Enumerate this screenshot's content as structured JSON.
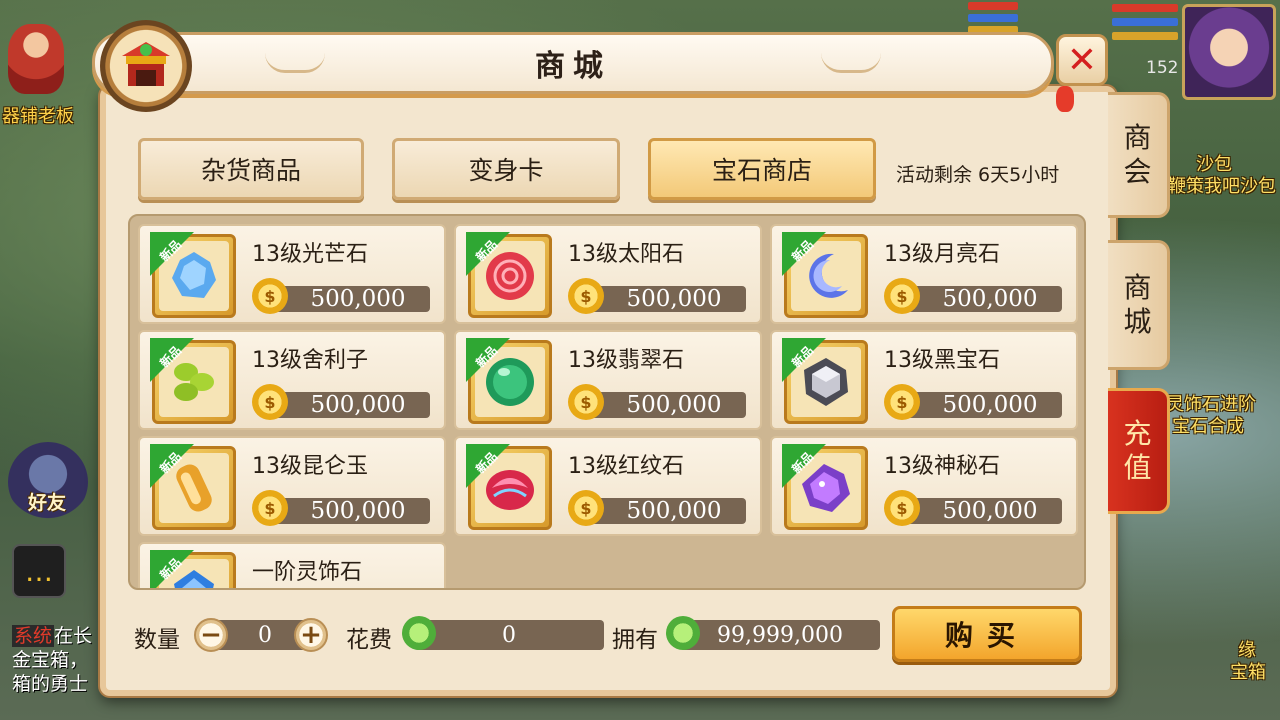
{
  "background": {
    "npc_name": "器铺老板",
    "level_text": "152",
    "friend_label": "好友",
    "scene_texts": [
      "沙包",
      "鞭策我吧沙包",
      "灵饰石进阶",
      "宝石合成",
      "缘",
      "宝箱"
    ],
    "system_chat": {
      "tag": "系统",
      "lines": [
        "在长",
        "金宝箱，",
        "箱的勇士"
      ]
    }
  },
  "window": {
    "title": "商城",
    "close_label": "✕"
  },
  "tabs": [
    {
      "label": "杂货商品",
      "active": false
    },
    {
      "label": "变身卡",
      "active": false
    },
    {
      "label": "宝石商店",
      "active": true
    }
  ],
  "activity": "活动剩余 6天5小时",
  "new_badge": "新品",
  "items": [
    {
      "name": "13级光芒石",
      "price": "500,000",
      "gem": "blue-crystal-icon"
    },
    {
      "name": "13级太阳石",
      "price": "500,000",
      "gem": "red-sun-stone-icon"
    },
    {
      "name": "13级月亮石",
      "price": "500,000",
      "gem": "blue-moon-stone-icon"
    },
    {
      "name": "13级舍利子",
      "price": "500,000",
      "gem": "green-relic-icon"
    },
    {
      "name": "13级翡翠石",
      "price": "500,000",
      "gem": "green-jade-orb-icon"
    },
    {
      "name": "13级黑宝石",
      "price": "500,000",
      "gem": "black-gem-icon"
    },
    {
      "name": "13级昆仑玉",
      "price": "500,000",
      "gem": "orange-jade-icon"
    },
    {
      "name": "13级红纹石",
      "price": "500,000",
      "gem": "red-swirl-stone-icon"
    },
    {
      "name": "13级神秘石",
      "price": "500,000",
      "gem": "purple-mystic-stone-icon"
    },
    {
      "name": "一阶灵饰石",
      "price": "",
      "gem": "blue-ornament-stone-icon"
    }
  ],
  "bottom": {
    "qty_label": "数量",
    "qty_value": "0",
    "minus": "−",
    "plus": "+",
    "cost_label": "花费",
    "cost_value": "0",
    "own_label": "拥有",
    "own_value": "99,999,000",
    "buy_label": "购买"
  },
  "side_tabs": [
    {
      "label": "商会"
    },
    {
      "label": "商城"
    },
    {
      "label": "充值"
    }
  ],
  "colors": {
    "accent": "#f3a52c",
    "price_bar": "#786552",
    "new_badge": "#2fa733",
    "recharge": "#c8281a"
  }
}
